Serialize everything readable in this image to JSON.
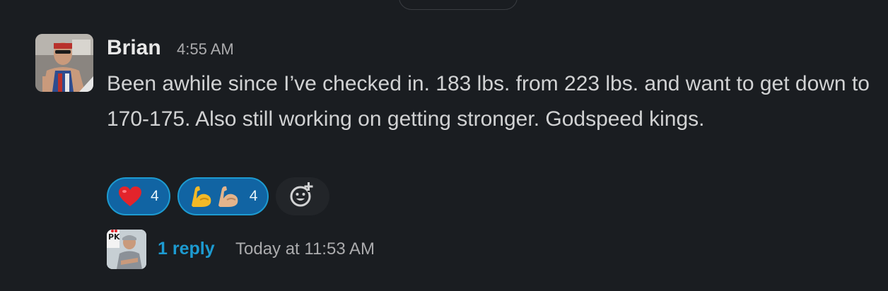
{
  "message": {
    "sender": "Brian",
    "time": "4:55 AM",
    "text": "Been awhile since I’ve checked in. 183 lbs. from 223 lbs. and want to get down to 170-175. Also still working on getting stronger. Godspeed kings."
  },
  "reactions": [
    {
      "emoji": "heart",
      "count": "4"
    },
    {
      "emoji": "flexed-biceps",
      "count": "4"
    }
  ],
  "add_reaction_icon": "add-emoji-icon",
  "thread": {
    "reply_count": "1 reply",
    "last_reply": "Today at 11:53 AM"
  },
  "colors": {
    "background": "#1a1d21",
    "reaction_bg": "#1164a3",
    "reaction_border": "#1d9bd1",
    "link": "#1d9bd1"
  }
}
